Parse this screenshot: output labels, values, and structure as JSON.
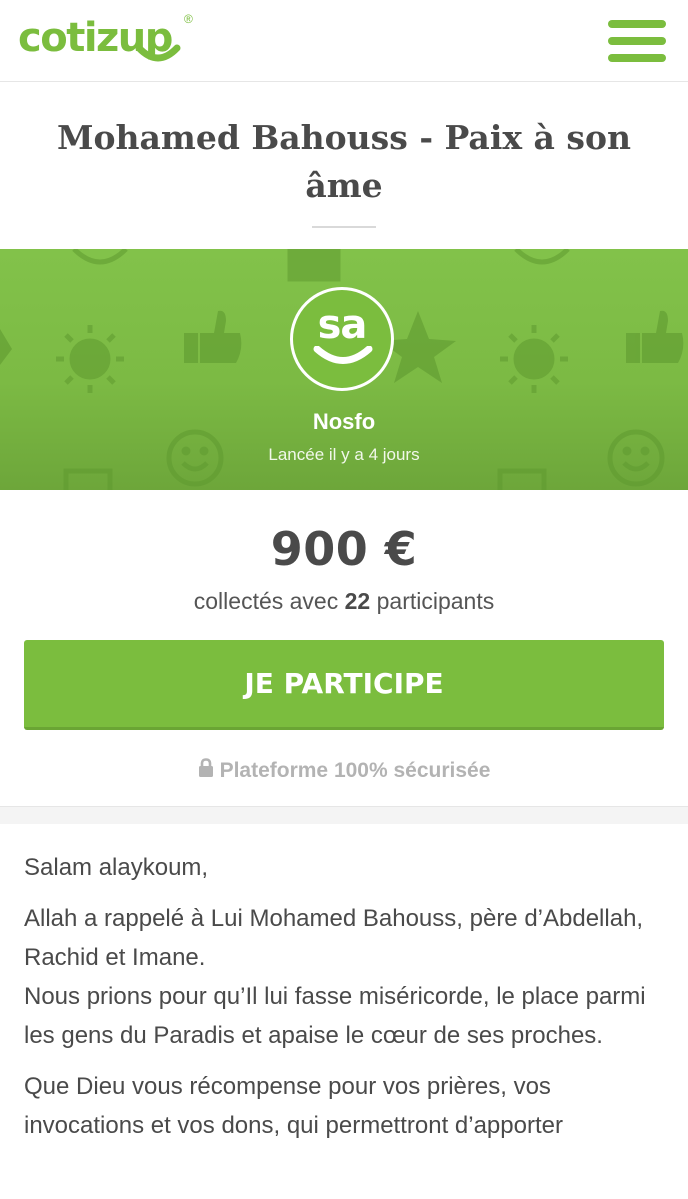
{
  "header": {
    "logo_text": "cotizup",
    "logo_registered": "®",
    "menu_icon": "hamburger-icon"
  },
  "campaign": {
    "title": "Mohamed Bahouss - Paix à son âme",
    "avatar_initials": "sa",
    "creator": "Nosfo",
    "launched": "Lancée il y a 4 jours"
  },
  "stats": {
    "amount": "900 €",
    "collected_prefix": "collectés avec",
    "participants_count": "22",
    "participants_suffix": "participants"
  },
  "actions": {
    "participate_label": "JE PARTICIPE"
  },
  "security": {
    "label": "Plateforme 100% sécurisée",
    "icon": "lock-icon"
  },
  "description": {
    "p1": "Salam alaykoum,",
    "p2_line1": "Allah a rappelé à Lui Mohamed Bahouss, père d’Abdellah, Rachid et Imane.",
    "p2_line2": "Nous prions pour qu’Il lui fasse miséricorde, le place parmi les gens du Paradis et apaise le cœur de ses proches.",
    "p3": "Que Dieu vous récompense pour vos prières, vos invocations et vos dons, qui permettront d’apporter"
  },
  "colors": {
    "brand_green": "#7bbd3e",
    "text_dark": "#4a4a4a",
    "text_muted": "#b3b3b3"
  }
}
